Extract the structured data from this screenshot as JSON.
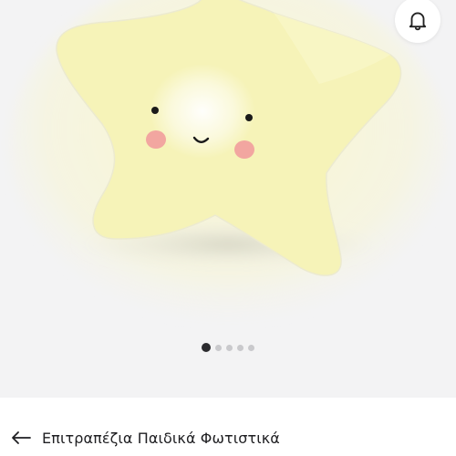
{
  "product": {
    "image_alt": "star-night-light"
  },
  "actions": {
    "notify_icon": "bell-icon"
  },
  "carousel": {
    "count": 5,
    "active_index": 0
  },
  "breadcrumb": {
    "back_icon": "arrow-left-icon",
    "label": "Επιτραπέζια Παιδικά Φωτιστικά"
  },
  "colors": {
    "gallery_bg": "#f3f3f4",
    "star": "#f6f3b8",
    "cheek": "#f2a6a0",
    "dot_active": "#2b2b2e",
    "dot_inactive": "#c9c9cc"
  }
}
